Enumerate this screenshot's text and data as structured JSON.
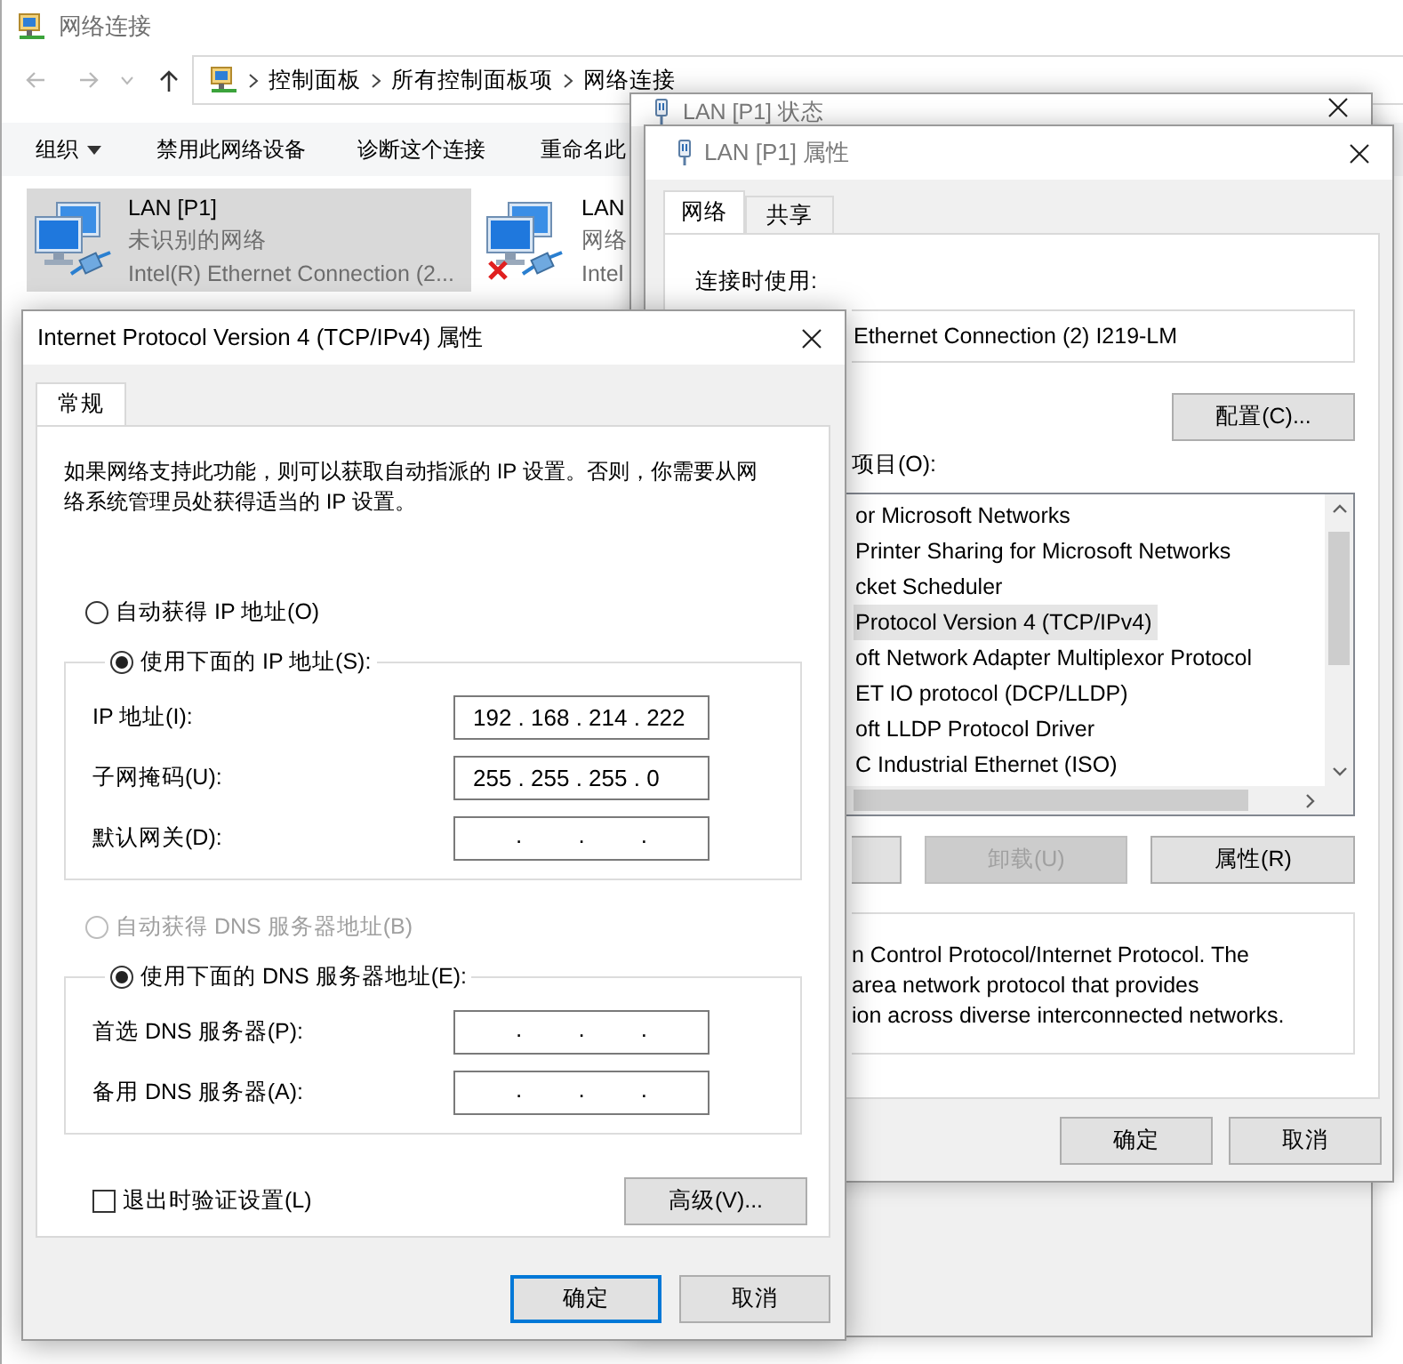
{
  "explorer": {
    "title": "网络连接",
    "breadcrumb": [
      "控制面板",
      "所有控制面板项",
      "网络连接"
    ],
    "toolbar": [
      {
        "label": "组织",
        "kind": "menu"
      },
      {
        "label": "禁用此网络设备",
        "kind": "button"
      },
      {
        "label": "诊断这个连接",
        "kind": "button"
      },
      {
        "label": "重命名此",
        "kind": "button"
      }
    ],
    "connections": [
      {
        "name": "LAN [P1]",
        "status": "未识别的网络",
        "adapter": "Intel(R) Ethernet Connection (2...",
        "selected": true,
        "disconnected": false
      },
      {
        "name": "LAN",
        "status": "网络",
        "adapter": "Intel",
        "selected": false,
        "disconnected": true
      }
    ]
  },
  "status_window": {
    "title": "LAN [P1] 状态"
  },
  "properties": {
    "title": "LAN [P1] 属性",
    "tabs": [
      {
        "label": "网络",
        "selected": true
      },
      {
        "label": "共享",
        "selected": false
      }
    ],
    "connect_using_label": "连接时使用:",
    "adapter": "Ethernet Connection (2) I219-LM",
    "configure_button": "配置(C)...",
    "items_label": "项目(O):",
    "items": [
      {
        "label": "or Microsoft Networks",
        "selected": false
      },
      {
        "label": "Printer Sharing for Microsoft Networks",
        "selected": false
      },
      {
        "label": "cket Scheduler",
        "selected": false
      },
      {
        "label": "Protocol Version 4 (TCP/IPv4)",
        "selected": true
      },
      {
        "label": "oft Network Adapter Multiplexor Protocol",
        "selected": false
      },
      {
        "label": "ET IO protocol (DCP/LLDP)",
        "selected": false
      },
      {
        "label": "oft LLDP Protocol Driver",
        "selected": false
      },
      {
        "label": "C Industrial Ethernet (ISO)",
        "selected": false
      }
    ],
    "buttons": [
      {
        "label": "卸载(U)",
        "disabled": true
      },
      {
        "label": "属性(R)",
        "disabled": false
      }
    ],
    "description": [
      "n Control Protocol/Internet Protocol. The",
      "area network protocol that provides",
      "ion across diverse interconnected networks."
    ],
    "dialog_buttons": [
      "确定",
      "取消"
    ]
  },
  "ipv4": {
    "title": "Internet Protocol Version 4 (TCP/IPv4) 属性",
    "tabs": [
      {
        "label": "常规",
        "selected": true
      }
    ],
    "intro": "如果网络支持此功能，则可以获取自动指派的 IP 设置。否则，你需要从网络系统管理员处获得适当的 IP 设置。",
    "ip_options": [
      {
        "label": "自动获得 IP 地址(O)",
        "selected": false,
        "disabled": false
      },
      {
        "label": "使用下面的 IP 地址(S):",
        "selected": true,
        "disabled": false
      }
    ],
    "ip_fields": [
      {
        "label": "IP 地址(I):",
        "value": "192 . 168 . 214 . 222"
      },
      {
        "label": "子网掩码(U):",
        "value": "255 . 255 . 255 . 0"
      },
      {
        "label": "默认网关(D):",
        "value": ". . ."
      }
    ],
    "dns_options": [
      {
        "label": "自动获得 DNS 服务器地址(B)",
        "selected": false,
        "disabled": true
      },
      {
        "label": "使用下面的 DNS 服务器地址(E):",
        "selected": true,
        "disabled": false
      }
    ],
    "dns_fields": [
      {
        "label": "首选 DNS 服务器(P):",
        "value": ". . ."
      },
      {
        "label": "备用 DNS 服务器(A):",
        "value": ". . ."
      }
    ],
    "validate": {
      "label": "退出时验证设置(L)",
      "checked": false
    },
    "advanced_button": "高级(V)...",
    "dialog_buttons": [
      {
        "label": "确定",
        "default": true
      },
      {
        "label": "取消",
        "default": false
      }
    ]
  }
}
